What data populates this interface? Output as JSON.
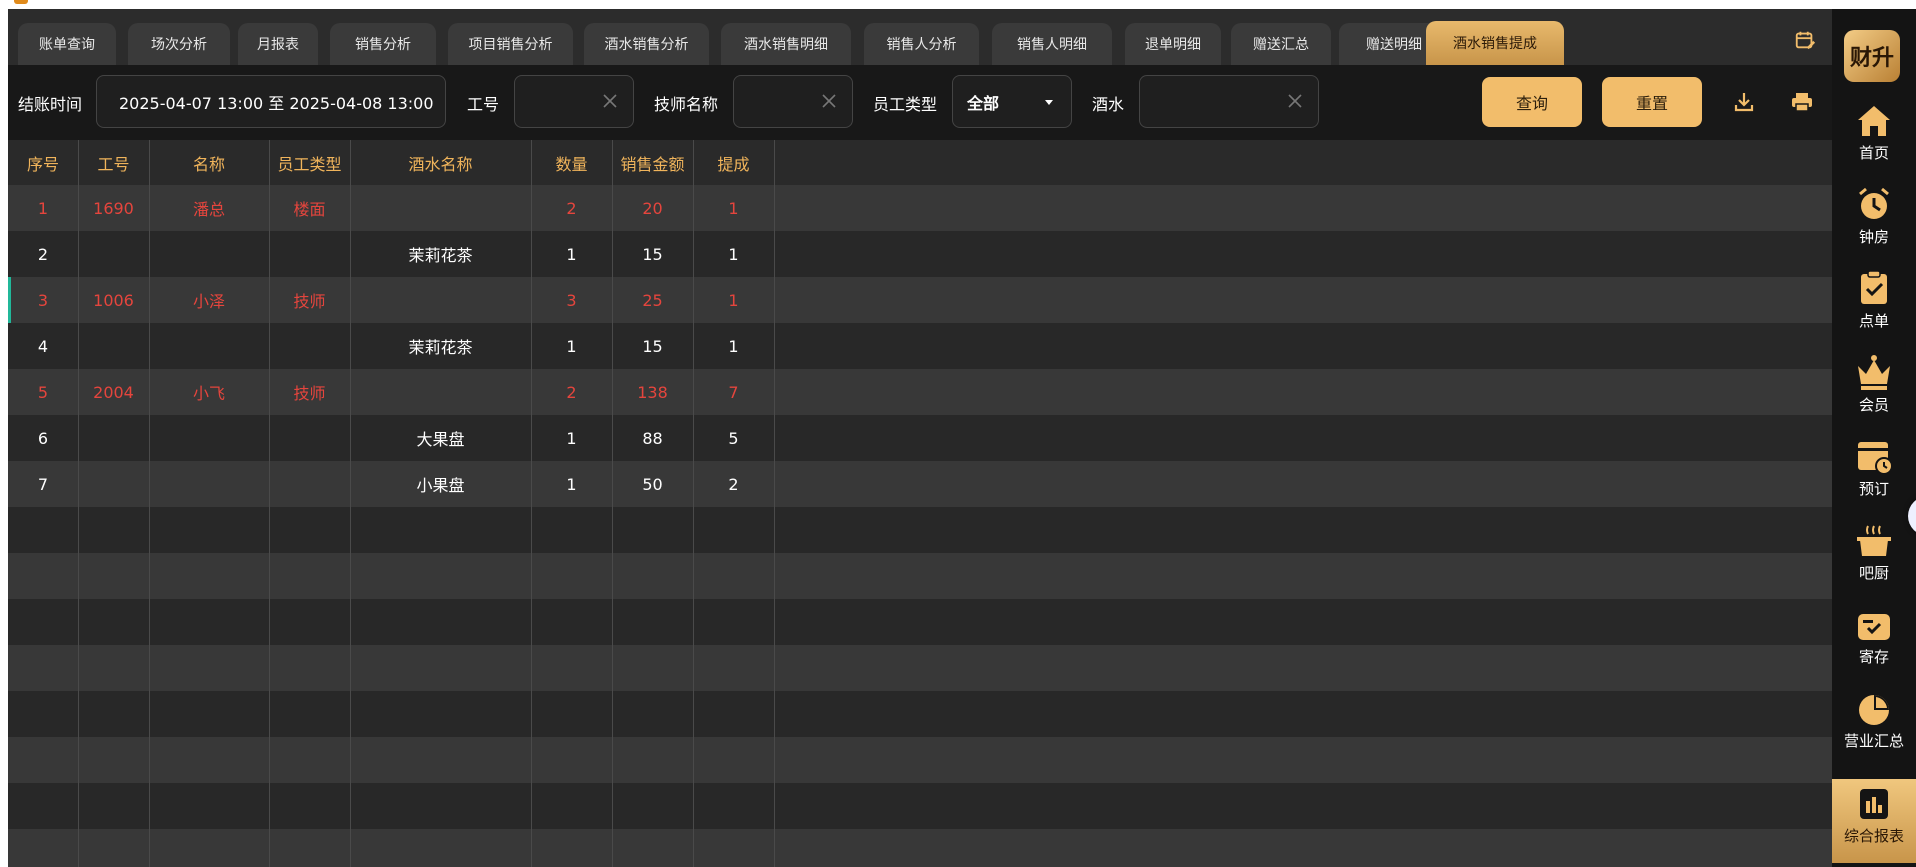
{
  "tabs": [
    {
      "label": "账单查询",
      "active": false
    },
    {
      "label": "场次分析",
      "active": false
    },
    {
      "label": "月报表",
      "active": false
    },
    {
      "label": "销售分析",
      "active": false
    },
    {
      "label": "项目销售分析",
      "active": false
    },
    {
      "label": "酒水销售分析",
      "active": false
    },
    {
      "label": "酒水销售明细",
      "active": false
    },
    {
      "label": "销售人分析",
      "active": false
    },
    {
      "label": "销售人明细",
      "active": false
    },
    {
      "label": "退单明细",
      "active": false
    },
    {
      "label": "赠送汇总",
      "active": false
    },
    {
      "label": "赠送明细",
      "active": false
    },
    {
      "label": "酒水销售提成",
      "active": true
    }
  ],
  "filters": {
    "checkout_time_label": "结账时间",
    "checkout_time_value": "2025-04-07 13:00 至 2025-04-08 13:00",
    "job_no_label": "工号",
    "job_no_value": "",
    "tech_name_label": "技师名称",
    "tech_name_value": "",
    "emp_type_label": "员工类型",
    "emp_type_value": "全部",
    "drink_label": "酒水",
    "drink_value": "",
    "query_button": "查询",
    "reset_button": "重置"
  },
  "table": {
    "headers": [
      "序号",
      "工号",
      "名称",
      "员工类型",
      "酒水名称",
      "数量",
      "销售金额",
      "提成"
    ],
    "rows": [
      {
        "cells": [
          "1",
          "1690",
          "潘总",
          "楼面",
          "",
          "2",
          "20",
          "1"
        ],
        "summary": true
      },
      {
        "cells": [
          "2",
          "",
          "",
          "",
          "茉莉花茶",
          "1",
          "15",
          "1"
        ],
        "summary": false
      },
      {
        "cells": [
          "3",
          "1006",
          "小泽",
          "技师",
          "",
          "3",
          "25",
          "1"
        ],
        "summary": true
      },
      {
        "cells": [
          "4",
          "",
          "",
          "",
          "茉莉花茶",
          "1",
          "15",
          "1"
        ],
        "summary": false
      },
      {
        "cells": [
          "5",
          "2004",
          "小飞",
          "技师",
          "",
          "2",
          "138",
          "7"
        ],
        "summary": true
      },
      {
        "cells": [
          "6",
          "",
          "",
          "",
          "大果盘",
          "1",
          "88",
          "5"
        ],
        "summary": false
      },
      {
        "cells": [
          "7",
          "",
          "",
          "",
          "小果盘",
          "1",
          "50",
          "2"
        ],
        "summary": false
      }
    ]
  },
  "nav": {
    "brand": "财升",
    "items": [
      {
        "label": "首页",
        "icon": "home-icon"
      },
      {
        "label": "钟房",
        "icon": "alarm-clock-icon"
      },
      {
        "label": "点单",
        "icon": "clipboard-check-icon"
      },
      {
        "label": "会员",
        "icon": "crown-icon"
      },
      {
        "label": "预订",
        "icon": "calendar-clock-icon"
      },
      {
        "label": "吧厨",
        "icon": "cooking-pot-icon"
      },
      {
        "label": "寄存",
        "icon": "storage-icon"
      },
      {
        "label": "营业汇总",
        "icon": "pie-chart-icon"
      },
      {
        "label": "综合报表",
        "icon": "report-icon",
        "active": true
      }
    ]
  },
  "colors": {
    "accent": "#f2bd6b",
    "header_text": "#f0b45b",
    "summary_row_text": "#e5453d",
    "background": "#1f1f1f"
  }
}
